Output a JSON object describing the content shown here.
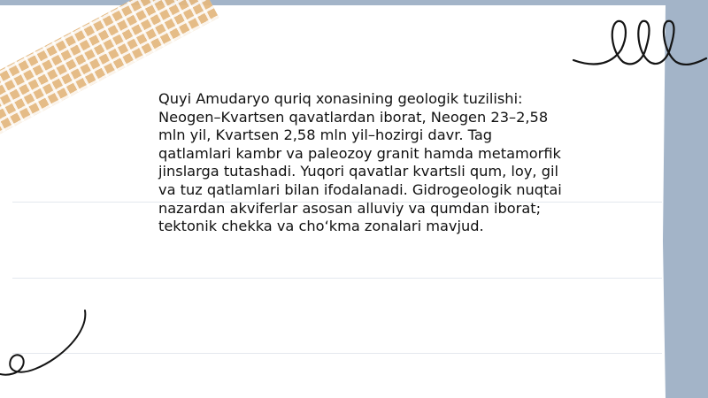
{
  "slide": {
    "body_text": "Quyi Amudaryo quriq xonasining geologik tuzilishi: Neogen–Kvartsen qavatlardan iborat, Neogen 23–2,58 mln yil, Kvartsen 2,58 mln yil–hozirgi davr. Tag qatlamlari kambr va paleozoy granit hamda metamorfik jinslarga tutashadi. Yuqori qavatlar kvartsli qum, loy, gil va tuz qatlamlari bilan ifodalanadi. Gidrogeologik nuqtai nazardan akviferlar asosan alluviy va qumdan iborat; tektonik chekka va cho‘kma zonalari mavjud."
  },
  "colors": {
    "background": "#a3b4c8",
    "paper": "#ffffff",
    "tape": "#e4b981",
    "ink": "#111111"
  }
}
